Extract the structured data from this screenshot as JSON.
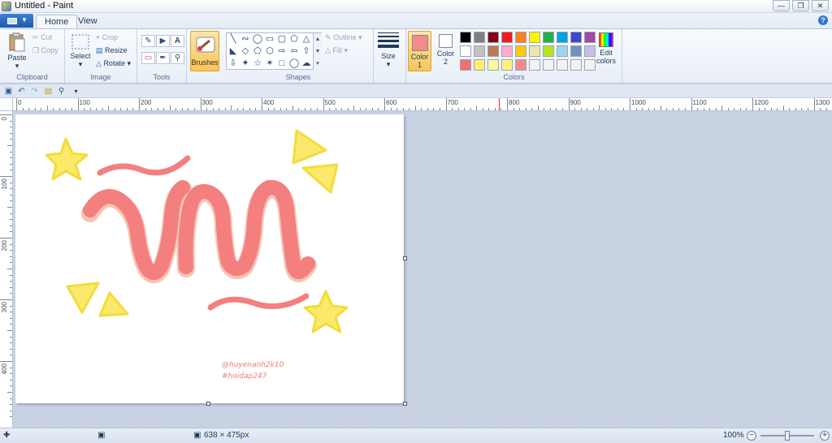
{
  "window": {
    "title": "Untitled - Paint",
    "controls": [
      "minimize",
      "restore",
      "close"
    ]
  },
  "tabs": [
    {
      "label": "Home",
      "active": true
    },
    {
      "label": "View",
      "active": false
    }
  ],
  "ribbon": {
    "clipboard": {
      "group_label": "Clipboard",
      "paste": "Paste",
      "cut": "Cut",
      "copy": "Copy"
    },
    "image": {
      "group_label": "Image",
      "select": "Select",
      "crop": "Crop",
      "resize": "Resize",
      "rotate": "Rotate"
    },
    "tools": {
      "group_label": "Tools",
      "items": [
        "pencil-icon",
        "fill-icon",
        "text-icon",
        "eraser-icon",
        "color-picker-icon",
        "magnifier-icon"
      ]
    },
    "brushes": {
      "label": "Brushes"
    },
    "shapes": {
      "group_label": "Shapes",
      "outline": "Outline",
      "fill": "Fill"
    },
    "size": {
      "label": "Size"
    },
    "colors": {
      "group_label": "Colors",
      "color1_label": "Color",
      "color1_num": "1",
      "color1_value": "#f28b8b",
      "color2_label": "Color",
      "color2_num": "2",
      "color2_value": "#ffffff",
      "palette": [
        "#000000",
        "#7f7f7f",
        "#880015",
        "#ed1c24",
        "#ff7f27",
        "#fff200",
        "#22b14c",
        "#00a2e8",
        "#3f48cc",
        "#a349a4",
        "#ffffff",
        "#c3c3c3",
        "#b97a57",
        "#ffaec9",
        "#ffc90e",
        "#efe4b0",
        "#b5e61d",
        "#99d9ea",
        "#7092be",
        "#c8bfe7",
        "#f07070",
        "#ffef70",
        "#fff6a0",
        "#fff080",
        "#f28b8b",
        "#f3f3f3",
        "#f3f3f3",
        "#f3f3f3",
        "#f3f3f3",
        "#f3f3f3"
      ],
      "edit_colors": "Edit colors"
    }
  },
  "ruler": {
    "horizontal": [
      "0",
      "100",
      "200",
      "300",
      "400",
      "500",
      "600",
      "700",
      "800",
      "900",
      "1000",
      "1100",
      "1200",
      "1300"
    ],
    "vertical": [
      "0",
      "100",
      "200",
      "300",
      "400"
    ]
  },
  "canvas": {
    "credit_line1": "@huyenanh2k10",
    "credit_line2": "#hoidap247",
    "drawing_colors": {
      "letters": "#f47f7f",
      "letters_shadow": "#f5c4b4",
      "stars": "#fbe96b",
      "stars_outline": "#f3dc3a"
    }
  },
  "status": {
    "dimensions": "638 × 475px",
    "zoom": "100%",
    "zoom_level": 0.5
  }
}
